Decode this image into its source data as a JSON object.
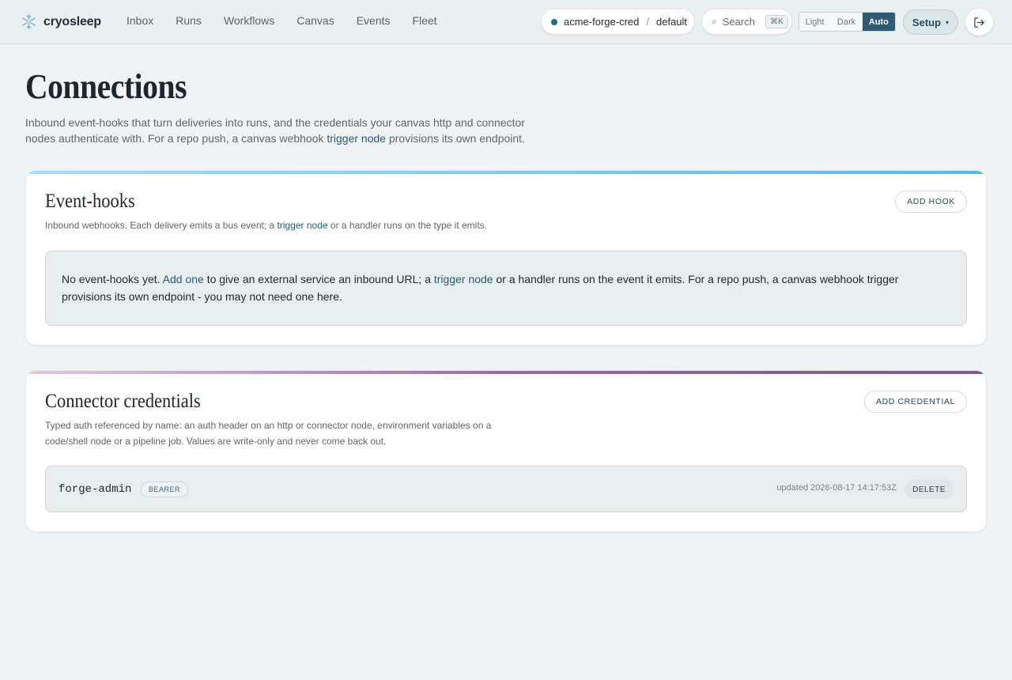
{
  "brand": {
    "name": "cryosleep"
  },
  "nav": [
    "Inbox",
    "Runs",
    "Workflows",
    "Canvas",
    "Events",
    "Fleet"
  ],
  "context": {
    "tenant": "acme-forge-cred",
    "separator": "/",
    "scope": "default"
  },
  "search": {
    "label": "Search",
    "shortcut": "⌘K"
  },
  "theme": {
    "light": "Light",
    "dark": "Dark",
    "auto": "Auto",
    "selected": "Auto"
  },
  "setup": {
    "label": "Setup",
    "caret": "▾"
  },
  "page": {
    "title": "Connections",
    "desc_1": "Inbound event-hooks that turn deliveries into runs, and the credentials your canvas http and connector nodes authenticate with. For a repo push, a canvas webhook ",
    "desc_link": "trigger node",
    "desc_2": " provisions its own endpoint."
  },
  "hooks": {
    "title": "Event-hooks",
    "desc_1": "Inbound webhooks. Each delivery emits a bus event; a ",
    "desc_link": "trigger node",
    "desc_2": " or a handler runs on the type it emits.",
    "add_label": "ADD HOOK",
    "empty_1": "No event-hooks yet. ",
    "empty_link_1": "Add one",
    "empty_2": " to give an external service an inbound URL; a ",
    "empty_link_2": "trigger node",
    "empty_3": " or a handler runs on the event it emits. For a repo push, a canvas webhook trigger provisions its own endpoint - you may not need one here."
  },
  "credentials": {
    "title": "Connector credentials",
    "desc": "Typed auth referenced by name: an auth header on an http or connector node, environment variables on a code/shell node or a pipeline job. Values are write-only and never come back out.",
    "add_label": "ADD CREDENTIAL",
    "items": [
      {
        "name": "forge-admin",
        "type": "BEARER",
        "updated": "updated 2026-08-17 14:17:53Z",
        "delete_label": "DELETE"
      }
    ]
  },
  "colors": {
    "accent": "#2e5a73",
    "link": "#245e7a",
    "hooks_band": "#5ab7e4",
    "creds_band": "#9a6b9b",
    "status_dot": "#1c6e8c"
  },
  "icons": {
    "logo": "snowflake-icon",
    "search": "magnifier-icon",
    "logout": "logout-icon"
  }
}
